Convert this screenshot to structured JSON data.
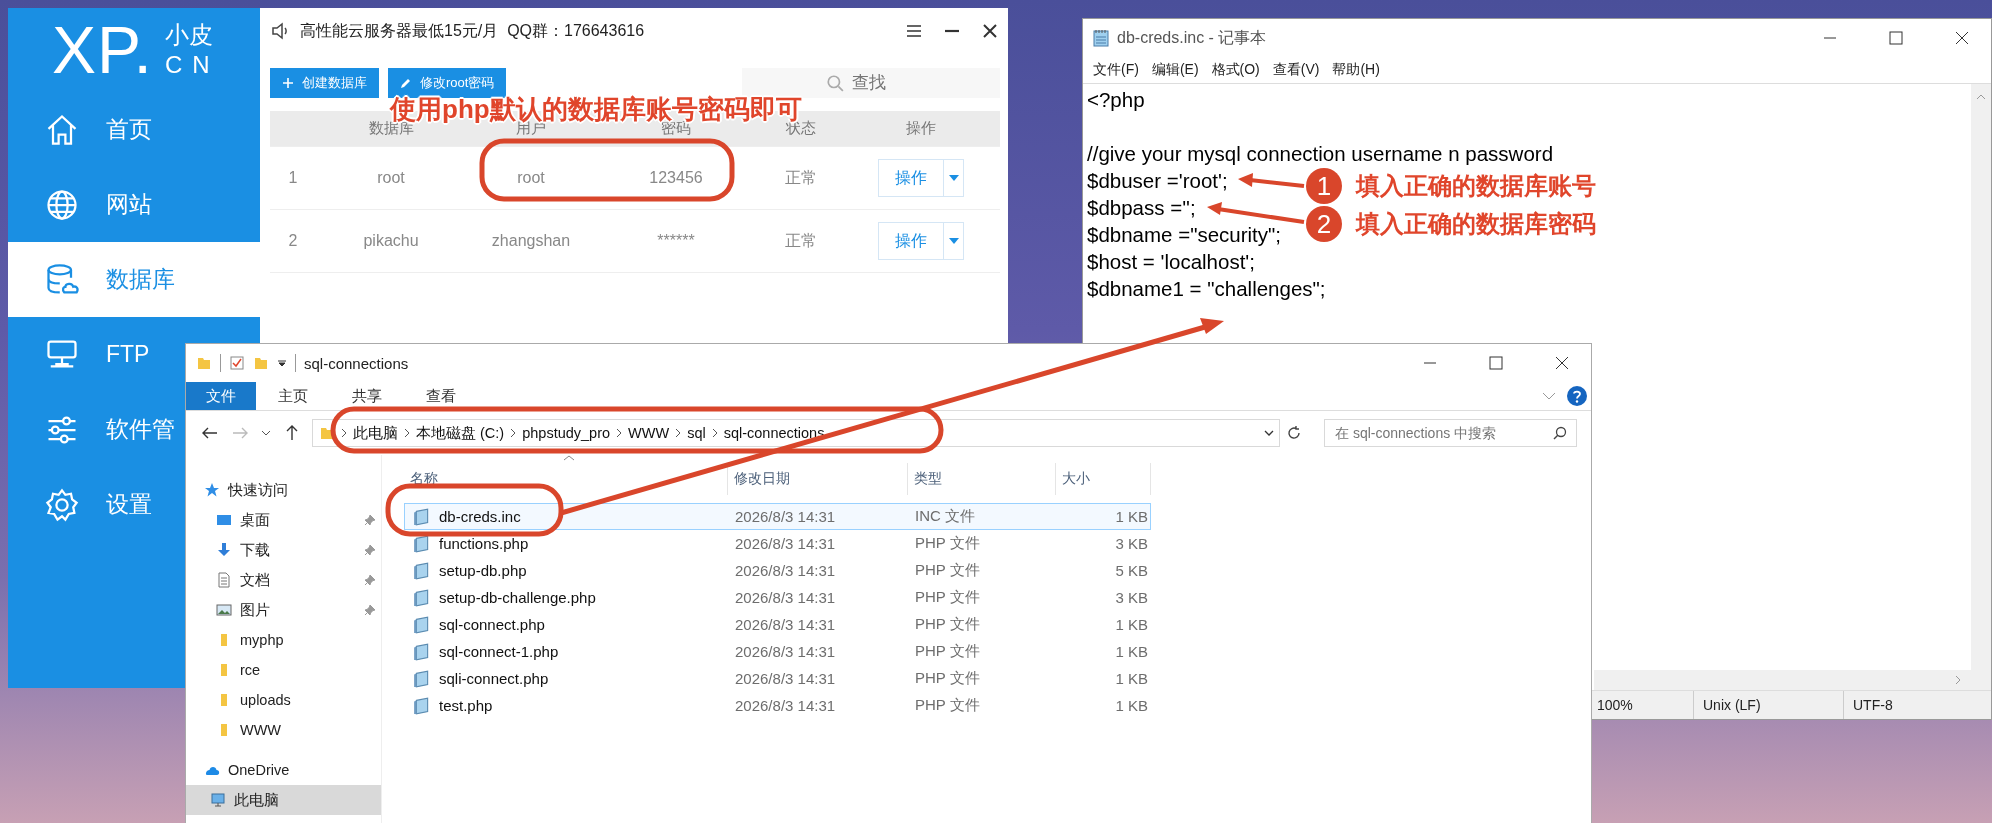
{
  "xp_app": {
    "logo": {
      "mark": "XP.",
      "top": "小皮",
      "bottom": "CN"
    },
    "sidebar": {
      "items": [
        {
          "label": "首页",
          "selected": false
        },
        {
          "label": "网站",
          "selected": false
        },
        {
          "label": "数据库",
          "selected": true
        },
        {
          "label": "FTP",
          "selected": false
        },
        {
          "label": "软件管",
          "selected": false
        },
        {
          "label": "设置",
          "selected": false
        }
      ]
    },
    "banner": "高性能云服务器最低15元/月  QQ群：176643616",
    "buttons": [
      {
        "label": "创建数据库",
        "kind": "add"
      },
      {
        "label": "修改root密码",
        "kind": "edit"
      }
    ],
    "search": {
      "placeholder": "查找"
    },
    "table": {
      "columns": [
        "数据库",
        "用户",
        "密码",
        "状态",
        "操作"
      ],
      "rows": [
        {
          "index": "1",
          "database": "root",
          "user": "root",
          "password": "123456",
          "status": "正常",
          "action": "操作"
        },
        {
          "index": "2",
          "database": "pikachu",
          "user": "zhangshan",
          "password": "******",
          "status": "正常",
          "action": "操作"
        }
      ]
    },
    "annotation": "使用php默认的数据库账号密码即可"
  },
  "notepad": {
    "title": "db-creds.inc - 记事本",
    "menu": [
      "文件(F)",
      "编辑(E)",
      "格式(O)",
      "查看(V)",
      "帮助(H)"
    ],
    "blocks": [
      [
        "<?php"
      ],
      [
        "//give your mysql connection username n password",
        "$dbuser ='root';",
        "$dbpass ='';",
        "$dbname =\"security\";",
        "$host = 'localhost';",
        "$dbname1 = \"challenges\";"
      ]
    ],
    "status": [
      "100%",
      "Unix (LF)",
      "UTF-8"
    ],
    "annotations": [
      {
        "number": "1",
        "text": "填入正确的数据库账号"
      },
      {
        "number": "2",
        "text": "填入正确的数据库密码"
      }
    ]
  },
  "explorer": {
    "title": "sql-connections",
    "ribbon_tabs": [
      {
        "label": "文件",
        "selected": true
      },
      {
        "label": "主页",
        "selected": false
      },
      {
        "label": "共享",
        "selected": false
      },
      {
        "label": "查看",
        "selected": false
      }
    ],
    "breadcrumb": [
      "此电脑",
      "本地磁盘 (C:)",
      "phpstudy_pro",
      "WWW",
      "sql",
      "sql-connections"
    ],
    "search": {
      "placeholder": "在 sql-connections 中搜索"
    },
    "nav": [
      {
        "label": "快速访问",
        "kind": "star",
        "pinned": false,
        "selected": false
      },
      {
        "label": "桌面",
        "kind": "desktop",
        "pinned": true,
        "selected": false
      },
      {
        "label": "下载",
        "kind": "download",
        "pinned": true,
        "selected": false
      },
      {
        "label": "文档",
        "kind": "document",
        "pinned": true,
        "selected": false
      },
      {
        "label": "图片",
        "kind": "picture",
        "pinned": true,
        "selected": false
      },
      {
        "label": "myphp",
        "kind": "folder",
        "pinned": false,
        "selected": false
      },
      {
        "label": "rce",
        "kind": "folder",
        "pinned": false,
        "selected": false
      },
      {
        "label": "uploads",
        "kind": "folder",
        "pinned": false,
        "selected": false
      },
      {
        "label": "WWW",
        "kind": "folder",
        "pinned": false,
        "selected": false
      },
      {
        "label": "OneDrive",
        "kind": "cloud",
        "pinned": false,
        "selected": false
      },
      {
        "label": "此电脑",
        "kind": "computer",
        "pinned": false,
        "selected": true
      }
    ],
    "columns": [
      "名称",
      "修改日期",
      "类型",
      "大小"
    ],
    "files": [
      {
        "name": "db-creds.inc",
        "date": "2026/8/3 14:31",
        "type": "INC 文件",
        "size": "1 KB",
        "selected": true
      },
      {
        "name": "functions.php",
        "date": "2026/8/3 14:31",
        "type": "PHP 文件",
        "size": "3 KB",
        "selected": false
      },
      {
        "name": "setup-db.php",
        "date": "2026/8/3 14:31",
        "type": "PHP 文件",
        "size": "5 KB",
        "selected": false
      },
      {
        "name": "setup-db-challenge.php",
        "date": "2026/8/3 14:31",
        "type": "PHP 文件",
        "size": "3 KB",
        "selected": false
      },
      {
        "name": "sql-connect.php",
        "date": "2026/8/3 14:31",
        "type": "PHP 文件",
        "size": "1 KB",
        "selected": false
      },
      {
        "name": "sql-connect-1.php",
        "date": "2026/8/3 14:31",
        "type": "PHP 文件",
        "size": "1 KB",
        "selected": false
      },
      {
        "name": "sqli-connect.php",
        "date": "2026/8/3 14:31",
        "type": "PHP 文件",
        "size": "1 KB",
        "selected": false
      },
      {
        "name": "test.php",
        "date": "2026/8/3 14:31",
        "type": "PHP 文件",
        "size": "1 KB",
        "selected": false
      }
    ]
  }
}
